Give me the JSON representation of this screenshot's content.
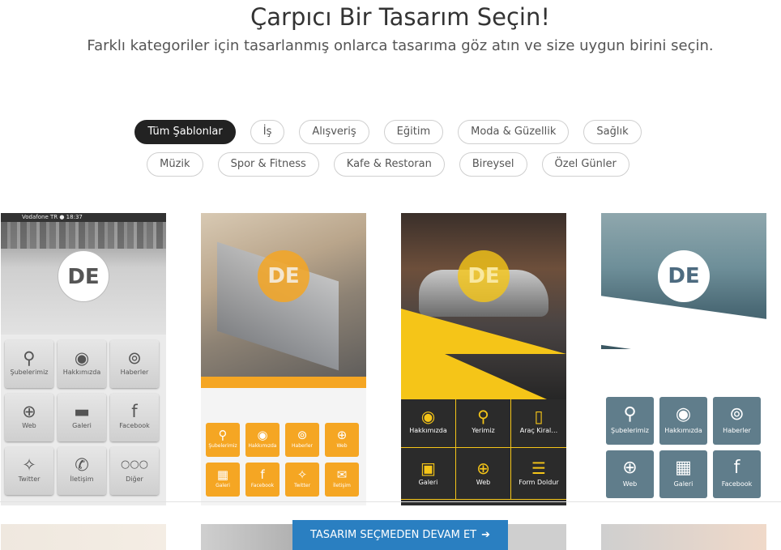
{
  "hero": {
    "title": "Çarpıcı Bir Tasarım Seçin!",
    "subtitle": "Farklı kategoriler için tasarlanmış onlarca tasarıma göz atın ve size uygun birini seçin."
  },
  "filters": {
    "row1": [
      "Tüm Şablonlar",
      "İş",
      "Alışveriş",
      "Eğitim",
      "Moda & Güzellik",
      "Sağlık"
    ],
    "row2": [
      "Müzik",
      "Spor & Fitness",
      "Kafe & Restoran",
      "Bireysel",
      "Özel Günler"
    ],
    "active": "Tüm Şablonlar"
  },
  "templates": {
    "logo_text": "DE",
    "t1": {
      "status": "Vodafone TR  ●  18:37",
      "tiles": [
        {
          "label": "Şubelerimiz",
          "icon": "map-pin-icon",
          "glyph": "⚲"
        },
        {
          "label": "Hakkımızda",
          "icon": "user-icon",
          "glyph": "◉"
        },
        {
          "label": "Haberler",
          "icon": "rss-icon",
          "glyph": "⊚"
        },
        {
          "label": "Web",
          "icon": "globe-icon",
          "glyph": "⊕"
        },
        {
          "label": "Galeri",
          "icon": "folder-icon",
          "glyph": "▬"
        },
        {
          "label": "Facebook",
          "icon": "facebook-icon",
          "glyph": "f"
        },
        {
          "label": "Twitter",
          "icon": "twitter-icon",
          "glyph": "✧"
        },
        {
          "label": "İletişim",
          "icon": "phone-icon",
          "glyph": "✆"
        },
        {
          "label": "Diğer",
          "icon": "more-icon",
          "glyph": "○○○"
        }
      ]
    },
    "t2": {
      "tiles": [
        {
          "label": "Şubelerimiz",
          "icon": "map-pin-icon",
          "glyph": "⚲"
        },
        {
          "label": "Hakkımızda",
          "icon": "user-icon",
          "glyph": "◉"
        },
        {
          "label": "Haberler",
          "icon": "rss-icon",
          "glyph": "⊚"
        },
        {
          "label": "Web",
          "icon": "globe-icon",
          "glyph": "⊕"
        },
        {
          "label": "Galeri",
          "icon": "grid-icon",
          "glyph": "▦"
        },
        {
          "label": "Facebook",
          "icon": "facebook-icon",
          "glyph": "f"
        },
        {
          "label": "Twitter",
          "icon": "twitter-icon",
          "glyph": "✧"
        },
        {
          "label": "İletişim",
          "icon": "mail-icon",
          "glyph": "✉"
        }
      ]
    },
    "t3": {
      "tiles": [
        {
          "label": "Hakkımızda",
          "icon": "user-icon",
          "glyph": "◉"
        },
        {
          "label": "Yerimiz",
          "icon": "map-pin-icon",
          "glyph": "⚲"
        },
        {
          "label": "Araç Kiral…",
          "icon": "phone-alert-icon",
          "glyph": "▯"
        },
        {
          "label": "Galeri",
          "icon": "image-icon",
          "glyph": "▣"
        },
        {
          "label": "Web",
          "icon": "globe-icon",
          "glyph": "⊕"
        },
        {
          "label": "Form Doldur",
          "icon": "form-icon",
          "glyph": "☰"
        }
      ]
    },
    "t4": {
      "tiles": [
        {
          "label": "Şubelerimiz",
          "icon": "map-pin-icon",
          "glyph": "⚲"
        },
        {
          "label": "Hakkımızda",
          "icon": "user-icon",
          "glyph": "◉"
        },
        {
          "label": "Haberler",
          "icon": "rss-icon",
          "glyph": "⊚"
        },
        {
          "label": "Web",
          "icon": "globe-icon",
          "glyph": "⊕"
        },
        {
          "label": "Galeri",
          "icon": "grid-icon",
          "glyph": "▦"
        },
        {
          "label": "Facebook",
          "icon": "facebook-icon",
          "glyph": "f"
        }
      ]
    }
  },
  "cta": {
    "label": "TASARIM SEÇMEDEN DEVAM ET",
    "arrow": "➔"
  },
  "colors": {
    "accent_blue": "#2a7fc1",
    "template_orange": "#f5a623",
    "template_yellow": "#f5c518",
    "template_slate": "#607d8b"
  }
}
